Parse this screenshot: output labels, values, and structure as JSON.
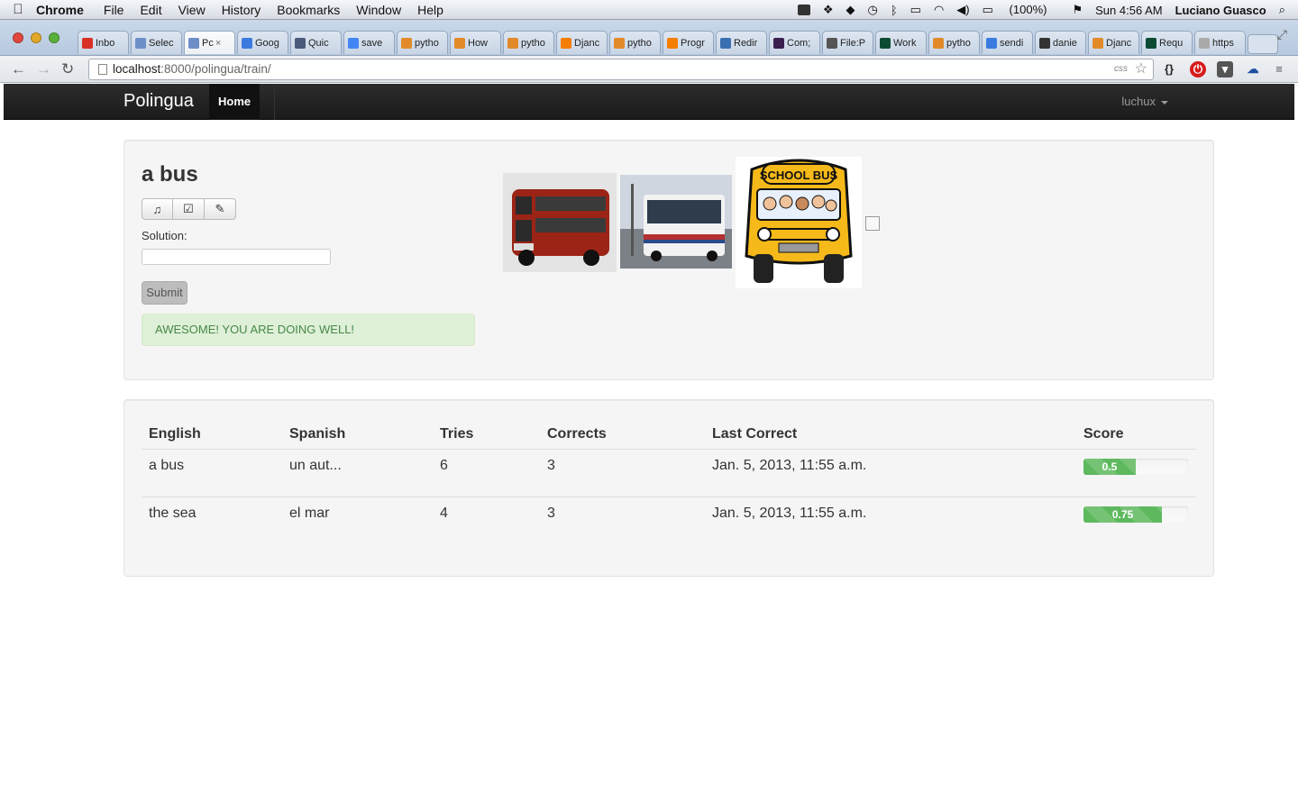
{
  "os_menubar": {
    "app_name": "Chrome",
    "menus": [
      "File",
      "Edit",
      "View",
      "History",
      "Bookmarks",
      "Window",
      "Help"
    ],
    "battery": "(100%)",
    "clock": "Sun 4:56 AM",
    "user": "Luciano Guasco"
  },
  "browser": {
    "tabs": [
      {
        "label": "Inbo",
        "icon": "gmail-icon",
        "color": "#d93025"
      },
      {
        "label": "Selec",
        "icon": "page-icon",
        "color": "#6d8fc7"
      },
      {
        "label": "Pc",
        "icon": "page-icon",
        "color": "#6d8fc7",
        "active": true
      },
      {
        "label": "Goog",
        "icon": "drive-icon",
        "color": "#3b7be0"
      },
      {
        "label": "Quic",
        "icon": "book-icon",
        "color": "#4a5a7a"
      },
      {
        "label": "save",
        "icon": "google-icon",
        "color": "#4285f4"
      },
      {
        "label": "pytho",
        "icon": "stack-icon",
        "color": "#e28a2a"
      },
      {
        "label": "How",
        "icon": "stack-icon",
        "color": "#e28a2a"
      },
      {
        "label": "pytho",
        "icon": "stack-icon",
        "color": "#e28a2a"
      },
      {
        "label": "Djanc",
        "icon": "blogger-icon",
        "color": "#f57d00"
      },
      {
        "label": "pytho",
        "icon": "stack-icon",
        "color": "#e28a2a"
      },
      {
        "label": "Progr",
        "icon": "blogger-icon",
        "color": "#f57d00"
      },
      {
        "label": "Redir",
        "icon": "pen-icon",
        "color": "#3a6fb0"
      },
      {
        "label": "Com;",
        "icon": "b-icon",
        "color": "#3a1f4f"
      },
      {
        "label": "File:P",
        "icon": "wikipedia-icon",
        "color": "#555555"
      },
      {
        "label": "Work",
        "icon": "django-icon",
        "color": "#0c4b33"
      },
      {
        "label": "pytho",
        "icon": "stack-icon",
        "color": "#e28a2a"
      },
      {
        "label": "sendi",
        "icon": "doc-icon",
        "color": "#3b7be0"
      },
      {
        "label": "danie",
        "icon": "github-icon",
        "color": "#333333"
      },
      {
        "label": "Djanc",
        "icon": "stack-icon",
        "color": "#e28a2a"
      },
      {
        "label": "Requ",
        "icon": "django-icon",
        "color": "#0c4b33"
      },
      {
        "label": "https",
        "icon": "page-icon",
        "color": "#aaaaaa"
      }
    ],
    "url_host": "localhost",
    "url_rest": ":8000/polingua/train/",
    "css_tag": "css"
  },
  "navbar": {
    "brand": "Polingua",
    "home": "Home",
    "user": "luchux"
  },
  "train": {
    "word": "a bus",
    "buttons": [
      {
        "icon": "music-note-icon",
        "glyph": "♫"
      },
      {
        "icon": "check-circle-icon",
        "glyph": "☑"
      },
      {
        "icon": "pencil-icon",
        "glyph": "✎"
      }
    ],
    "solution_label": "Solution:",
    "solution_value": "",
    "submit": "Submit",
    "alert": "AWESOME! YOU ARE DOING WELL!",
    "school_bus_sign": "SCHOOL BUS"
  },
  "stats": {
    "headers": [
      "English",
      "Spanish",
      "Tries",
      "Corrects",
      "Last Correct",
      "Score"
    ],
    "rows": [
      {
        "english": "a bus",
        "spanish": "un aut...",
        "tries": "6",
        "corrects": "3",
        "last_correct": "Jan. 5, 2013, 11:55 a.m.",
        "score": "0.5",
        "score_value": 0.5
      },
      {
        "english": "the sea",
        "spanish": "el mar",
        "tries": "4",
        "corrects": "3",
        "last_correct": "Jan. 5, 2013, 11:55 a.m.",
        "score": "0.75",
        "score_value": 0.75
      }
    ]
  },
  "colors": {
    "navbar": "#1b1b1b",
    "success_bg": "#dff0d8",
    "success_text": "#468847",
    "progress_bar": "#5eb95e"
  }
}
